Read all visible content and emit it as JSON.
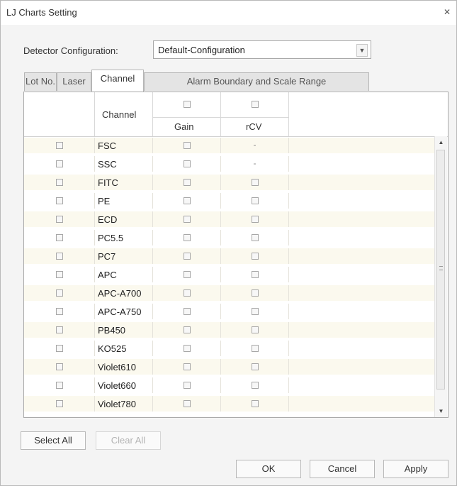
{
  "window": {
    "title": "LJ Charts Setting",
    "close_glyph": "✕"
  },
  "detector": {
    "label": "Detector Configuration:",
    "value": "Default-Configuration"
  },
  "tabs": [
    {
      "label": "Lot No.",
      "active": false
    },
    {
      "label": "Laser",
      "active": false
    },
    {
      "label": "Channel",
      "active": true
    },
    {
      "label": "Alarm Boundary and Scale Range",
      "active": false
    }
  ],
  "grid": {
    "header": {
      "channel": "Channel",
      "gain": "Gain",
      "rcv": "rCV"
    },
    "rows": [
      {
        "channel": "FSC",
        "rcv_dash": "-"
      },
      {
        "channel": "SSC",
        "rcv_dash": "-"
      },
      {
        "channel": "FITC"
      },
      {
        "channel": "PE"
      },
      {
        "channel": "ECD"
      },
      {
        "channel": "PC5.5"
      },
      {
        "channel": "PC7"
      },
      {
        "channel": "APC"
      },
      {
        "channel": "APC-A700"
      },
      {
        "channel": "APC-A750"
      },
      {
        "channel": "PB450"
      },
      {
        "channel": "KO525"
      },
      {
        "channel": "Violet610"
      },
      {
        "channel": "Violet660"
      },
      {
        "channel": "Violet780"
      }
    ]
  },
  "icons": {
    "scroll_up": "up-arrow-icon",
    "scroll_down": "down-arrow-icon",
    "dropdown": "chevron-down-icon"
  },
  "buttons": {
    "select_all": "Select All",
    "clear_all": "Clear All",
    "ok": "OK",
    "cancel": "Cancel",
    "apply": "Apply"
  }
}
